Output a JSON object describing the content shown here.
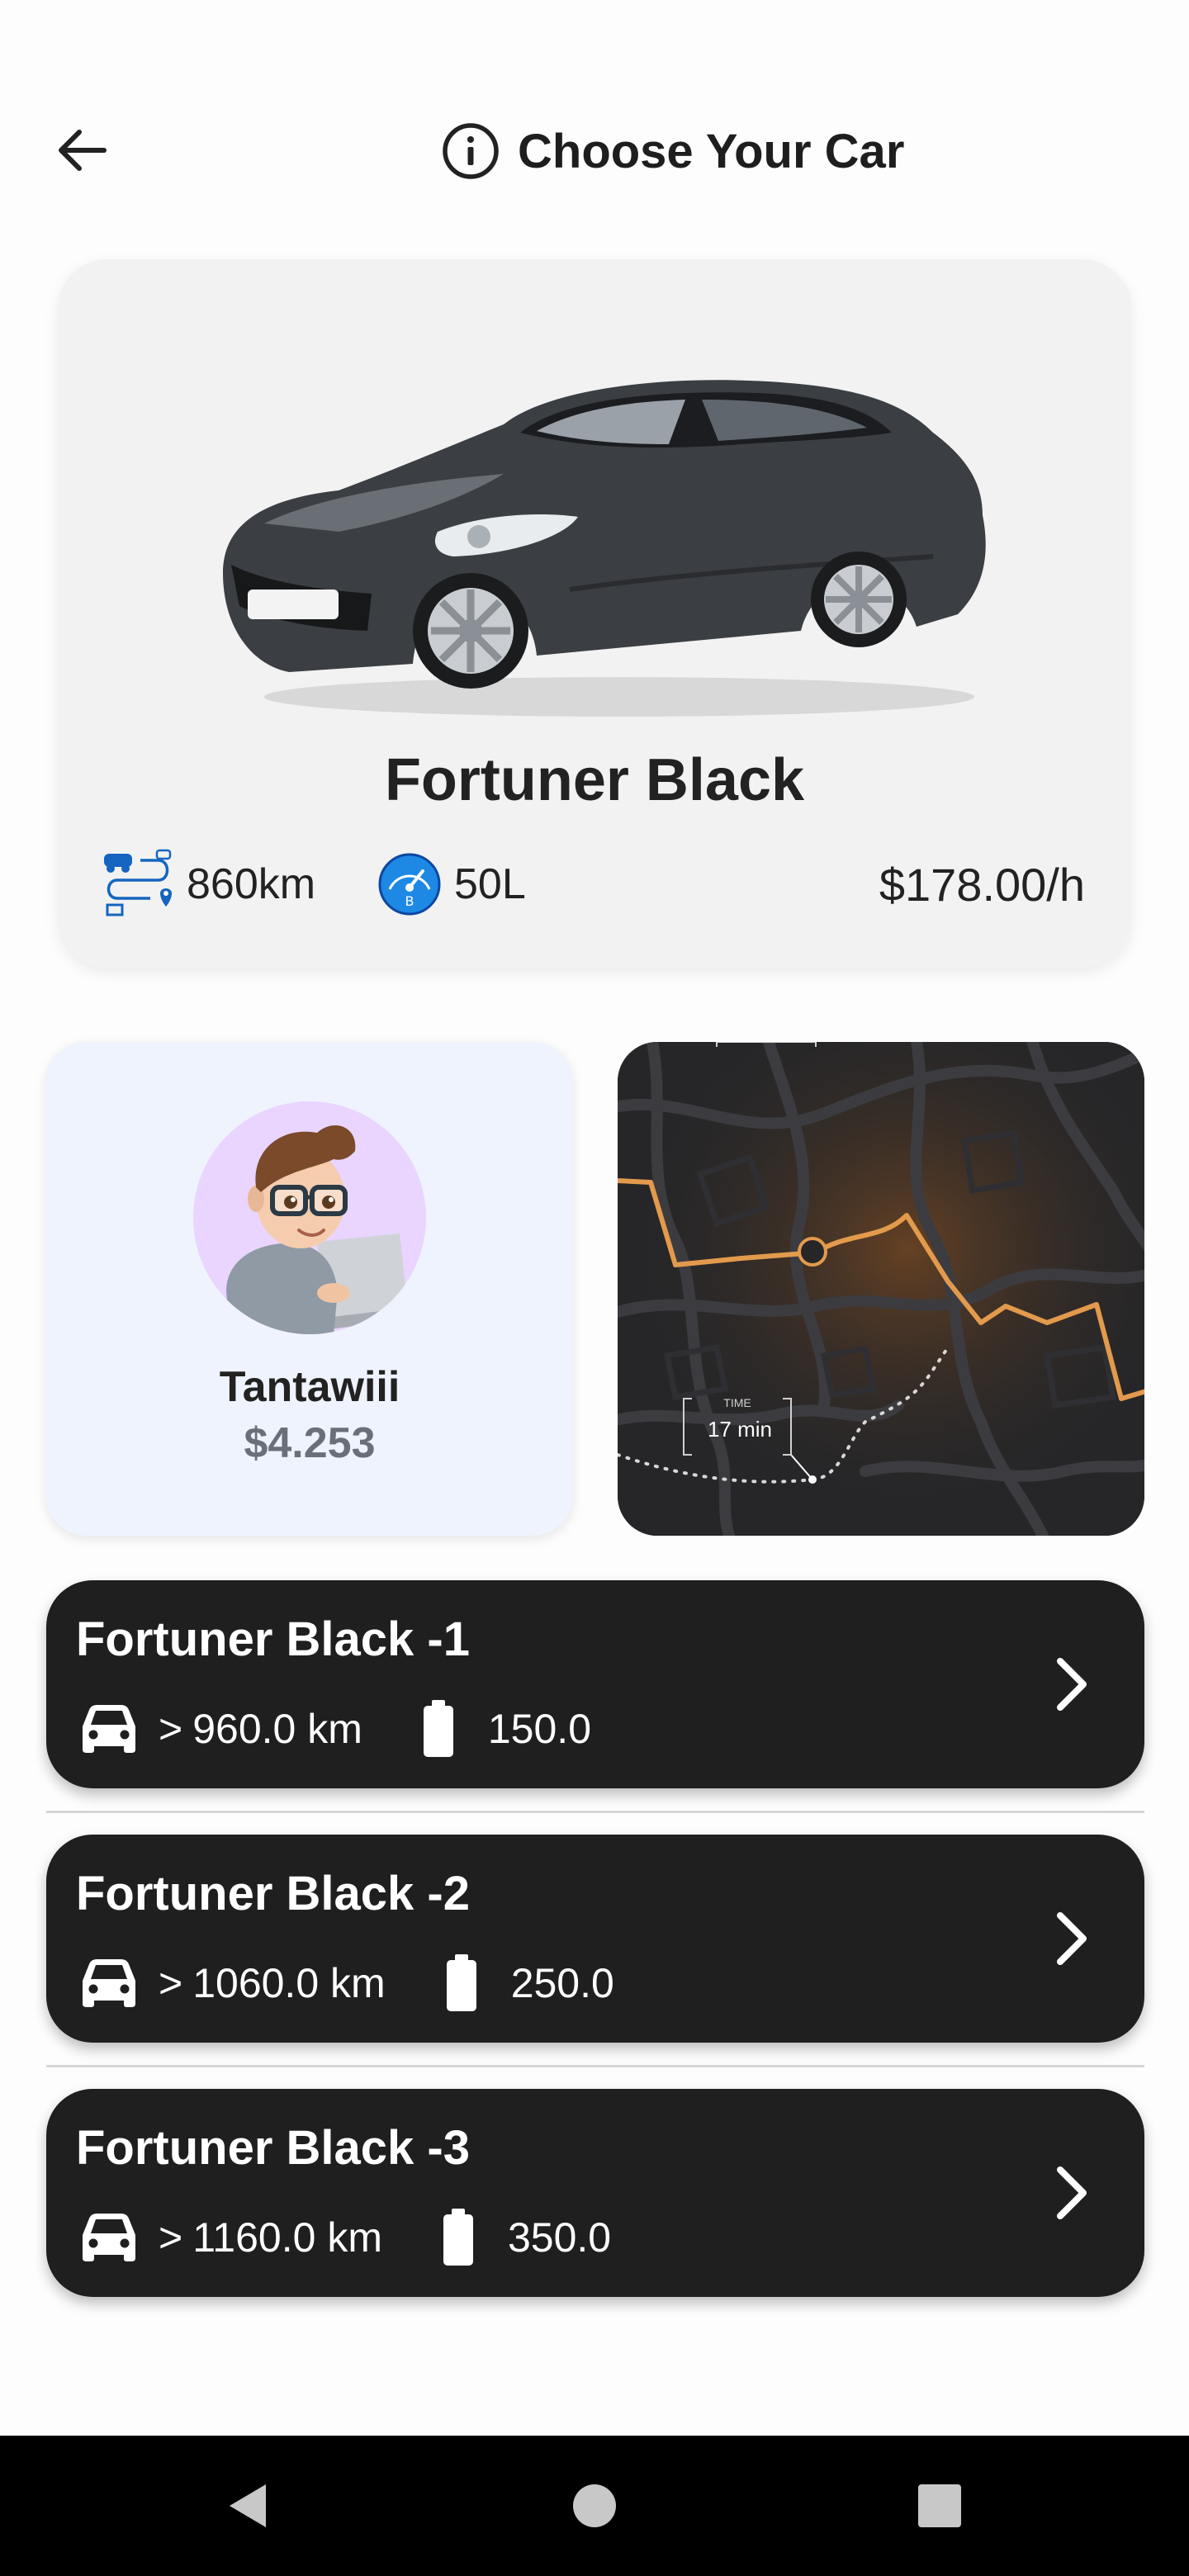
{
  "header": {
    "title": "Choose Your Car",
    "back_icon": "arrow-left-icon",
    "info_icon": "info-circle-icon"
  },
  "hero": {
    "car_name": "Fortuner Black",
    "distance": "860km",
    "fuel": "50L",
    "price": "$178.00/h",
    "car_color": "#3b3e42"
  },
  "profile": {
    "name": "Tantawiii",
    "balance": "$4.253"
  },
  "map": {
    "time_label": "TIME",
    "time_value": "17 min",
    "route_color": "#e39a4c"
  },
  "cars": [
    {
      "name": "Fortuner Black -1",
      "prefix": ">",
      "distance": "960.0 km",
      "battery": "150.0"
    },
    {
      "name": "Fortuner Black -2",
      "prefix": ">",
      "distance": "1060.0 km",
      "battery": "250.0"
    },
    {
      "name": "Fortuner Black -3",
      "prefix": ">",
      "distance": "1160.0 km",
      "battery": "350.0"
    }
  ],
  "colors": {
    "card_dark": "#1f1f1f",
    "hero_bg": "#f2f2f2",
    "profile_bg": "#eff3fd",
    "accent_blue": "#1565c0"
  }
}
